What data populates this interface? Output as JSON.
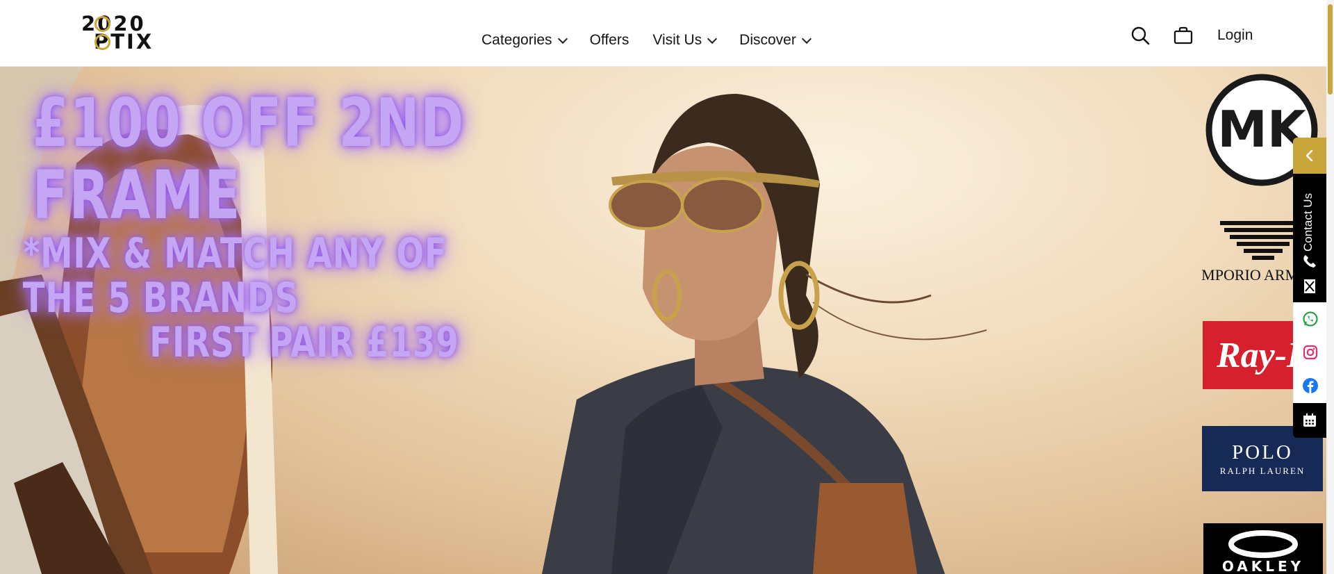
{
  "logo": {
    "line1": "2020",
    "line2": "PTIX",
    "alt": "2020 Optix"
  },
  "nav": [
    {
      "label": "Categories",
      "has_dropdown": true
    },
    {
      "label": "Offers",
      "has_dropdown": false
    },
    {
      "label": "Visit Us",
      "has_dropdown": true
    },
    {
      "label": "Discover",
      "has_dropdown": true
    }
  ],
  "header_icons": [
    "search-icon",
    "shopping-bag-icon"
  ],
  "login_label": "Login",
  "hero": {
    "headline": "£100 OFF 2ND FRAME",
    "subline": "*MIX & MATCH ANY OF THE 5 BRANDS",
    "price_line": "FIRST PAIR £139"
  },
  "brands": {
    "michael_kors": "MK",
    "emporio_armani": "EMPORIO ARMANI",
    "rayban": "Ray-Ban",
    "polo_title": "POLO",
    "polo_sub": "RALPH LAUREN",
    "oakley": "OAKLEY"
  },
  "contact_tab": {
    "label": "Contact Us",
    "icons": [
      "chevron-left-icon",
      "phone-icon",
      "email-icon",
      "whatsapp-icon",
      "instagram-icon",
      "facebook-icon",
      "calendar-icon"
    ]
  },
  "colors": {
    "accent": "#c9a53a",
    "promo_text": "#c4a6f5",
    "rayban_red": "#d6202d",
    "polo_navy": "#162a55"
  }
}
